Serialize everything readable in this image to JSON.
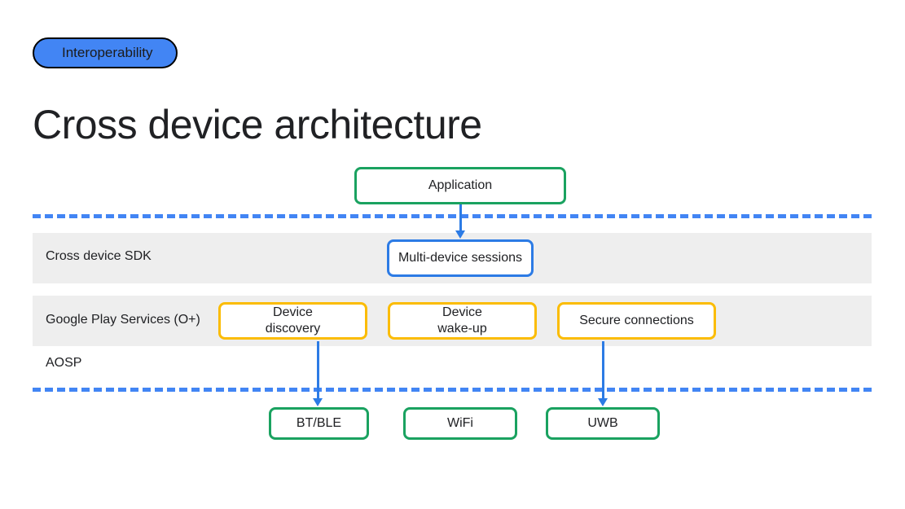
{
  "pill": "Interoperability",
  "title": "Cross device architecture",
  "bands": {
    "sdk": "Cross device SDK",
    "gps": "Google Play Services (O+)",
    "aosp": "AOSP"
  },
  "boxes": {
    "application": "Application",
    "mds": "Multi-device sessions",
    "device_discovery": "Device\ndiscovery",
    "device_wakeup": "Device\nwake-up",
    "secure_connections": "Secure connections",
    "bt": "BT/BLE",
    "wifi": "WiFi",
    "uwb": "UWB"
  }
}
